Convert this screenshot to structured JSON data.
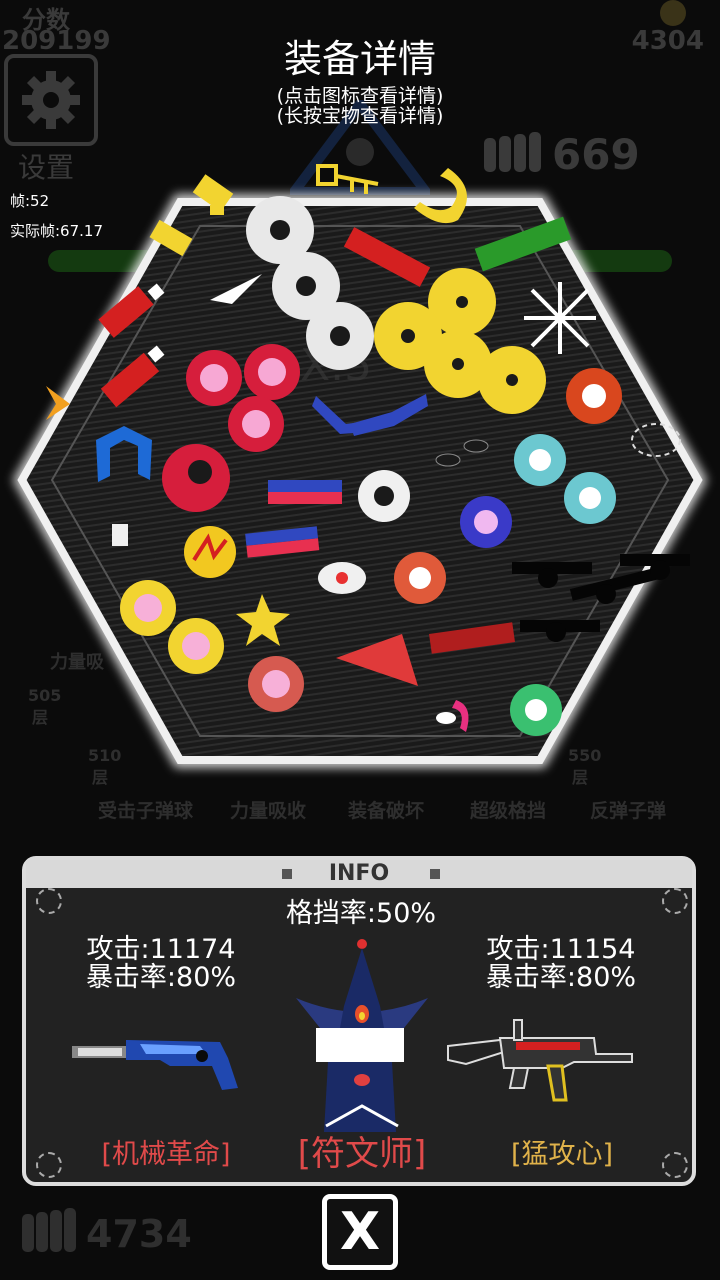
{
  "hud": {
    "score_label": "分数",
    "score_value": "209199",
    "coins_value": "4304",
    "settings_label": "设置",
    "fps": "帧:52",
    "real_fps": "实际帧:67.17",
    "ammo_count": "669",
    "bottom_ammo": "4734"
  },
  "header": {
    "title": "装备详情",
    "subtitle_line1": "(点击图标查看详情)",
    "subtitle_line2": "(长按宝物查看详情)"
  },
  "background": {
    "floor_505": "505",
    "floor_510": "510",
    "floor_550": "550",
    "floor_unit": "层",
    "skill_force": "力量吸",
    "skill_labels": [
      "受击子弹球",
      "力量吸收",
      "装备破坏",
      "超级格挡",
      "反弹子弹"
    ]
  },
  "info": {
    "header": "INFO",
    "block_rate": "格挡率:50%",
    "left_attack": "攻击:11174",
    "left_crit": "暴击率:80%",
    "right_attack": "攻击:11154",
    "right_crit": "暴击率:80%",
    "left_weapon_name": "[机械革命]",
    "center_name": "[符文师]",
    "right_weapon_name": "[猛攻心]"
  },
  "close_button": {
    "label": "X"
  },
  "colors": {
    "background": "#0b0b0b",
    "panel": "#222222",
    "name_red": "#e04a4a",
    "name_gold": "#e0b24a",
    "gear_yellow": "#f2d430",
    "gear_red": "#d61e3c"
  },
  "icons": [
    "gear-icon",
    "coin-icon",
    "ammo-icon",
    "skull-icon",
    "close-icon"
  ]
}
